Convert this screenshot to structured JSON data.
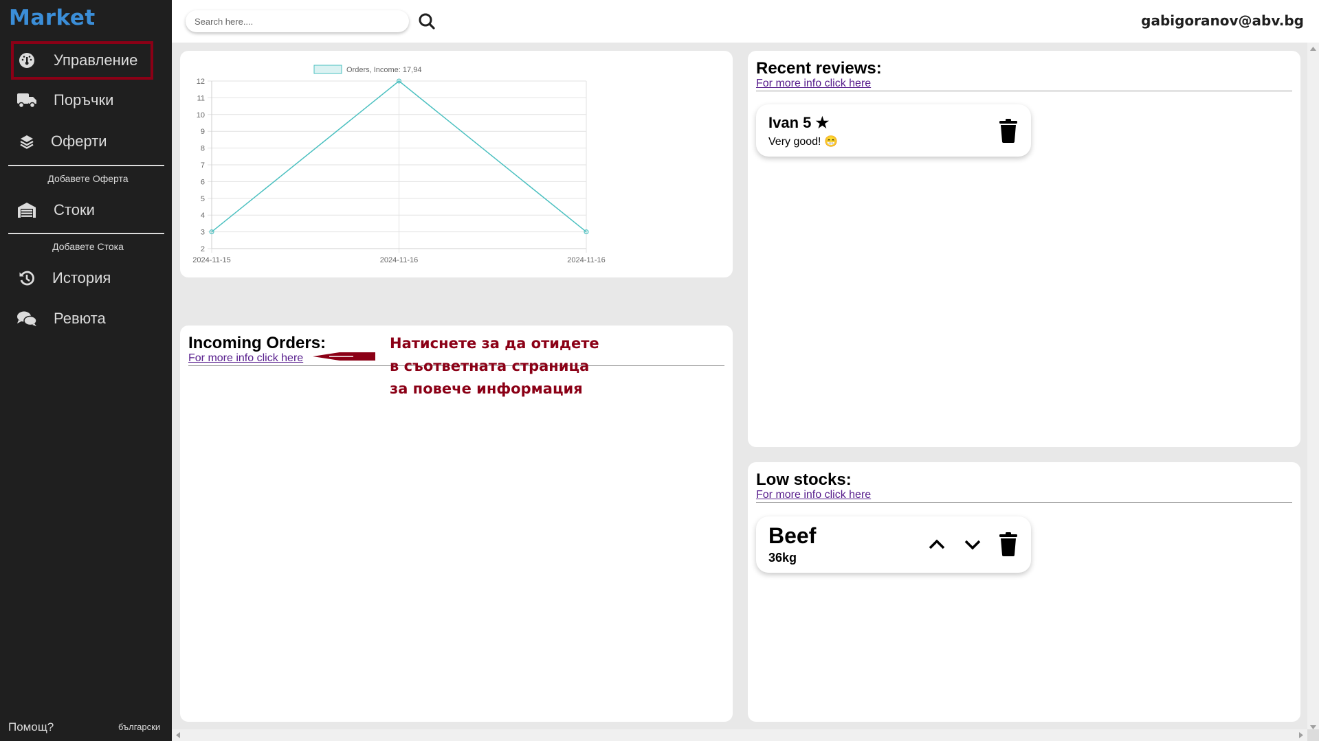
{
  "sidebar": {
    "logo": "Market",
    "items": [
      {
        "label": "Управление",
        "icon": "dashboard-gauge-icon",
        "active": true
      },
      {
        "label": "Поръчки",
        "icon": "truck-icon"
      },
      {
        "label": "Оферти",
        "icon": "layers-icon"
      },
      {
        "label": "Стоки",
        "icon": "warehouse-icon"
      },
      {
        "label": "История",
        "icon": "history-icon"
      },
      {
        "label": "Ревюта",
        "icon": "comments-icon"
      }
    ],
    "sub_add_offer": "Добавете Оферта",
    "sub_add_stock": "Добавете Стока",
    "help": "Помощ?",
    "language": "български"
  },
  "header": {
    "search_placeholder": "Search here....",
    "search_value": "",
    "user_email": "gabigoranov@abv.bg"
  },
  "colors": {
    "sidebar_bg": "#1f1f1f",
    "logo": "#3b8ed8",
    "accent_annotation": "#8b0016",
    "chart_line": "#4bc0c0",
    "link": "#551a8b"
  },
  "chart_data": {
    "type": "line",
    "title": "",
    "legend": "Orders, Income: 17,94",
    "legend_position": "top",
    "categories": [
      "2024-11-15",
      "2024-11-16",
      "2024-11-16"
    ],
    "series": [
      {
        "name": "Orders, Income: 17,94",
        "values": [
          3,
          12,
          3
        ]
      }
    ],
    "yticks": [
      2,
      3,
      4,
      5,
      6,
      7,
      8,
      9,
      10,
      11,
      12
    ],
    "ylim": [
      2,
      12
    ],
    "xlabel": "",
    "ylabel": "",
    "grid": true
  },
  "incoming_orders": {
    "title": "Incoming Orders:",
    "link": "For more info click here",
    "annotation": [
      "Натиснете за да отидете",
      "в съответната страница",
      "за повече информация"
    ]
  },
  "reviews": {
    "title": "Recent reviews:",
    "link": "For more info click here",
    "items": [
      {
        "name_rating": "Ivan 5 ★",
        "text": "Very good! 😁"
      }
    ]
  },
  "low_stocks": {
    "title": "Low stocks:",
    "link": "For more info click here",
    "items": [
      {
        "name": "Beef",
        "quantity": "36kg"
      }
    ]
  }
}
